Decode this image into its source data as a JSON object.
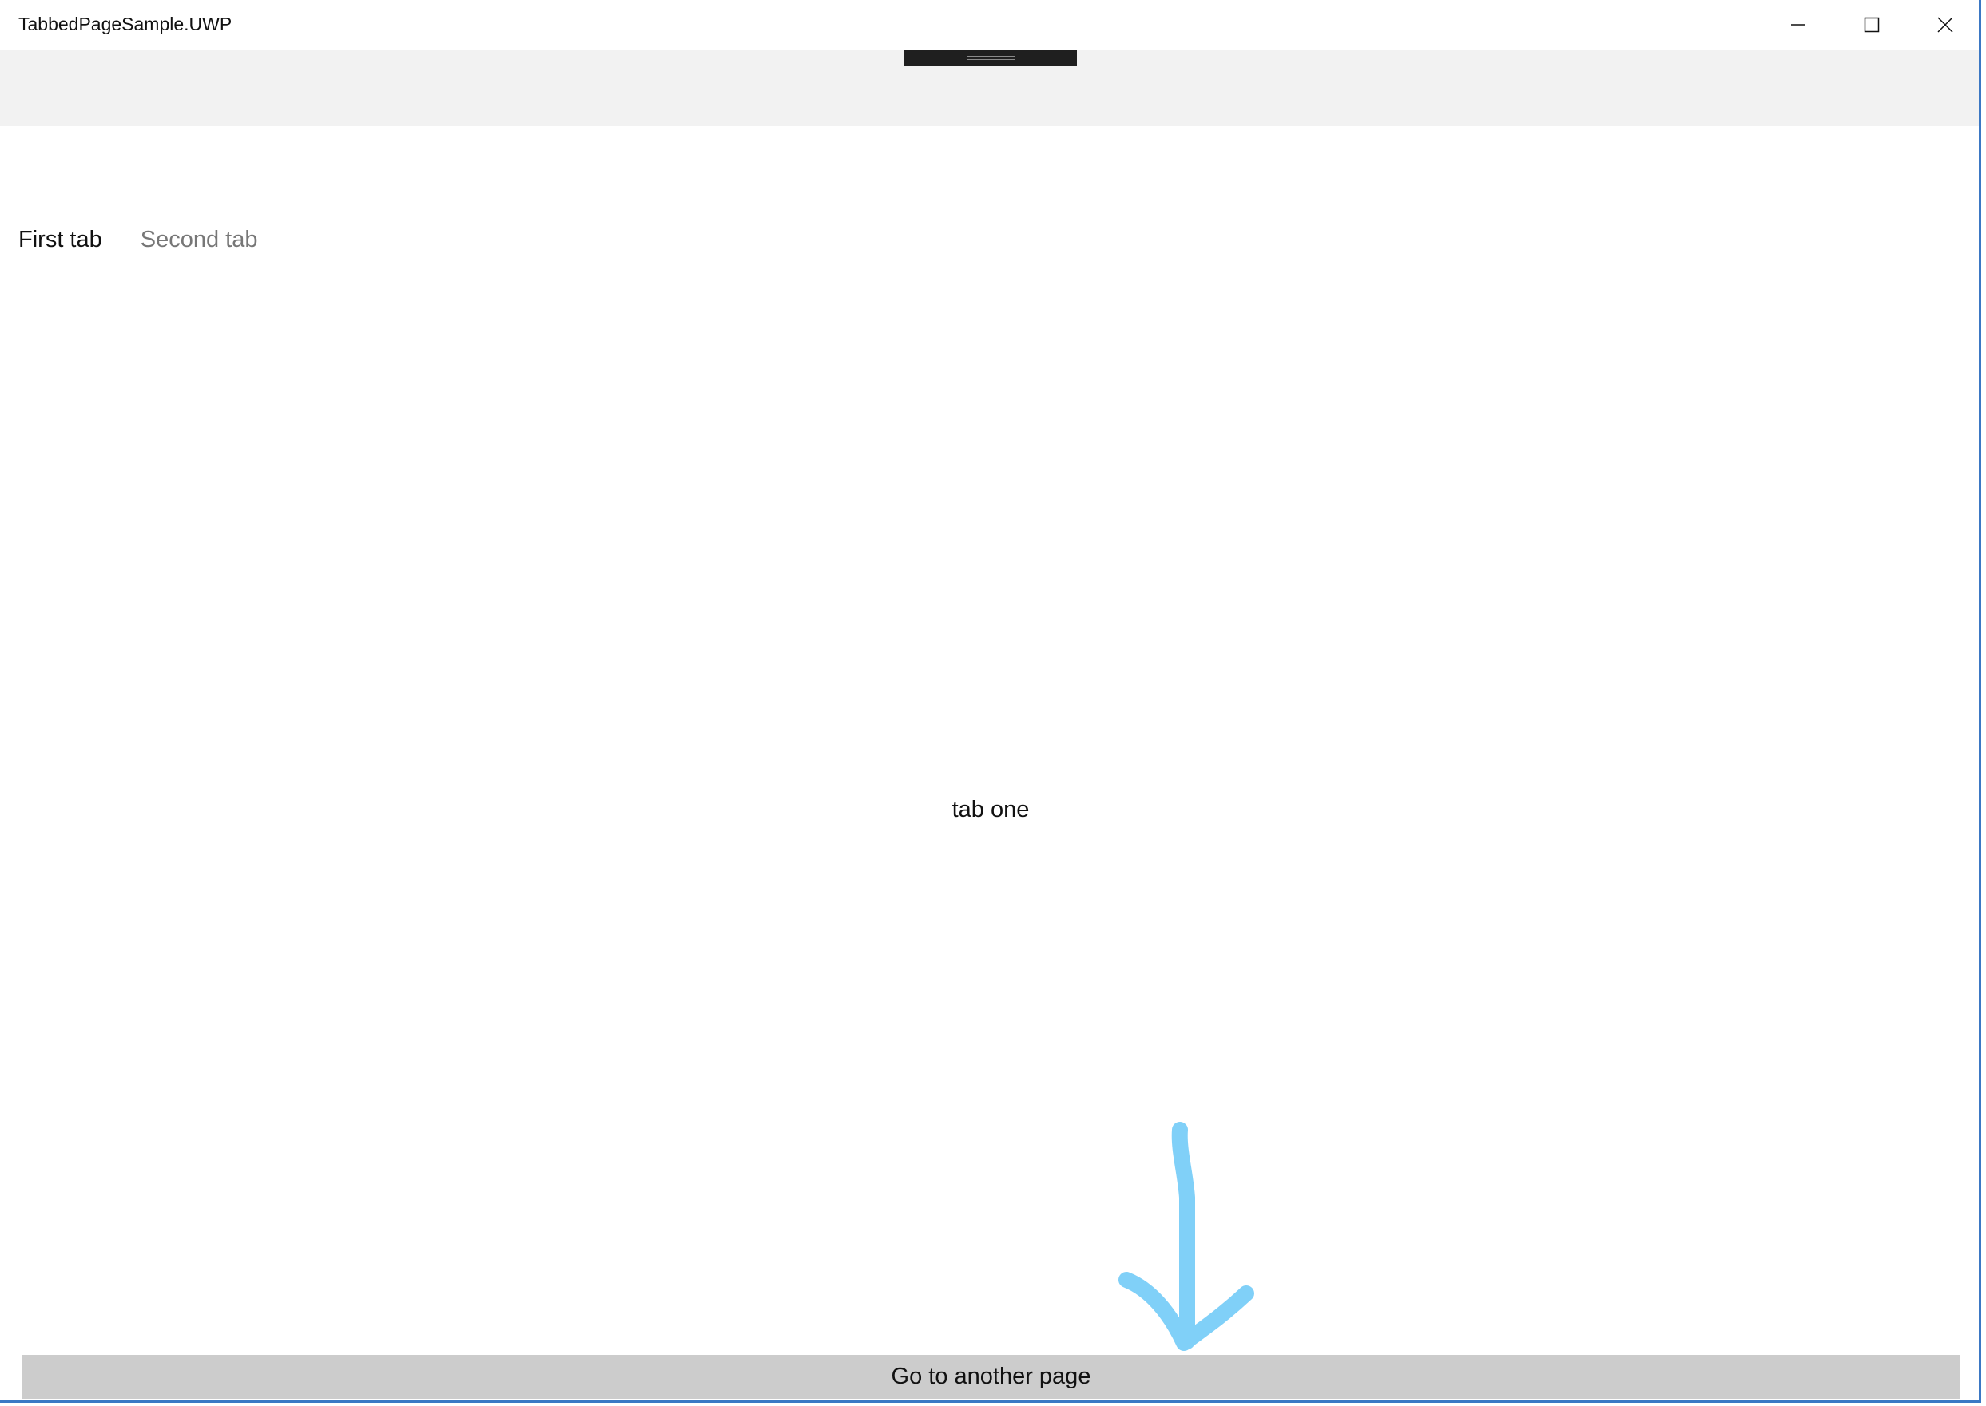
{
  "window": {
    "title": "TabbedPageSample.UWP",
    "accent_color": "#3b78c4"
  },
  "caption_buttons": {
    "minimize_icon": "minimize-icon",
    "maximize_icon": "maximize-icon",
    "close_icon": "close-icon"
  },
  "tabs": [
    {
      "label": "First tab",
      "selected": true
    },
    {
      "label": "Second tab",
      "selected": false
    }
  ],
  "content": {
    "text": "tab one"
  },
  "annotation": {
    "shape": "hand-drawn-down-arrow",
    "color": "#80d0f8"
  },
  "action_button": {
    "label": "Go to another page",
    "background": "#cccccc"
  }
}
